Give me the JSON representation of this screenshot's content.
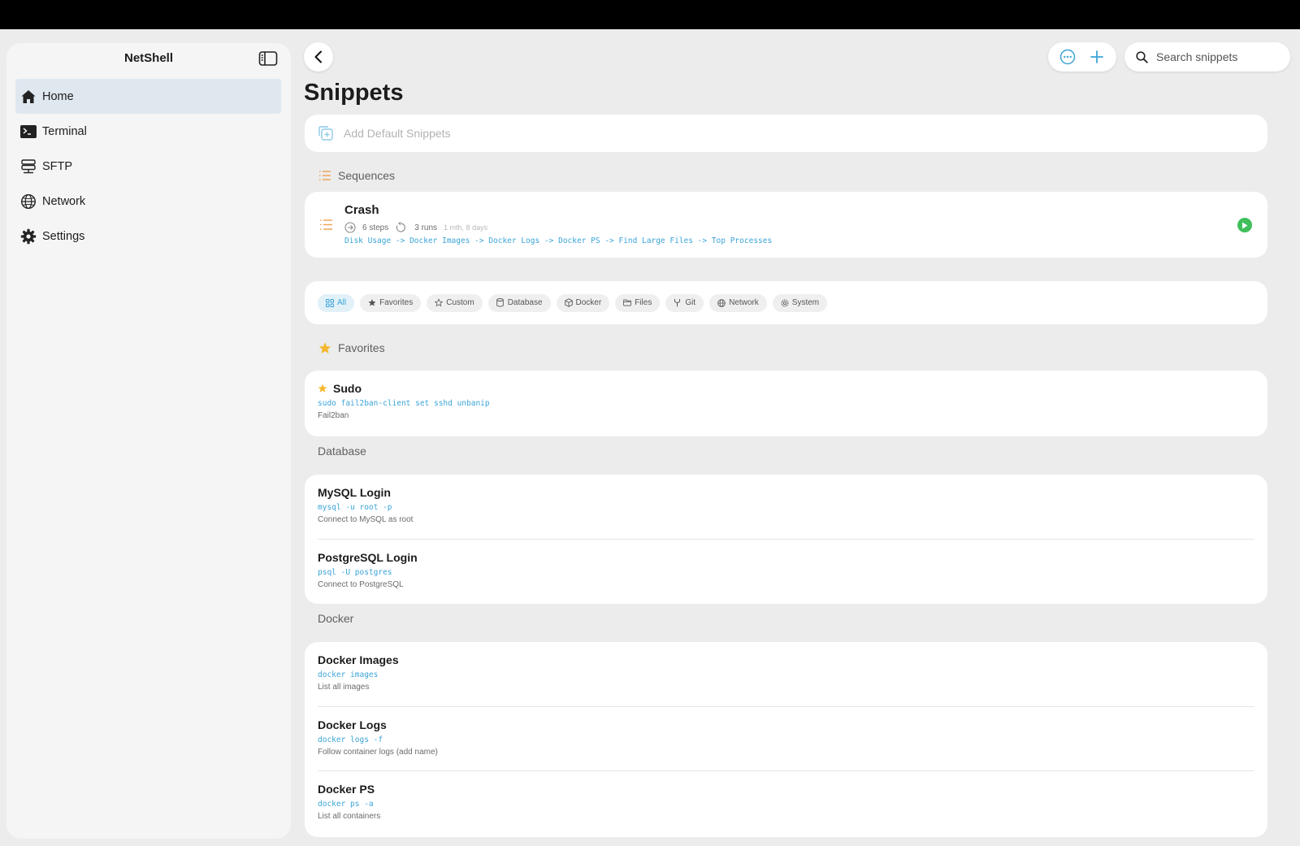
{
  "app": {
    "title": "NetShell"
  },
  "sidebar": {
    "items": [
      {
        "label": "Home",
        "icon": "house-icon"
      },
      {
        "label": "Terminal",
        "icon": "terminal-icon"
      },
      {
        "label": "SFTP",
        "icon": "sftp-icon"
      },
      {
        "label": "Network",
        "icon": "globe-icon"
      },
      {
        "label": "Settings",
        "icon": "gear-icon"
      }
    ],
    "active": "Home"
  },
  "header": {
    "title": "Snippets",
    "search_placeholder": "Search snippets"
  },
  "add_default": {
    "label": "Add Default Snippets"
  },
  "sequences": {
    "header": "Sequences",
    "items": [
      {
        "name": "Crash",
        "steps": "6 steps",
        "runs": "3 runs",
        "last_run": "1 mth, 8 days",
        "flow": "Disk Usage -> Docker Images -> Docker Logs -> Docker PS -> Find Large Files -> Top Processes"
      }
    ]
  },
  "filters": [
    {
      "label": "All",
      "icon": "grid-icon",
      "active": true
    },
    {
      "label": "Favorites",
      "icon": "star-filled-icon",
      "active": false
    },
    {
      "label": "Custom",
      "icon": "star-outline-icon",
      "active": false
    },
    {
      "label": "Database",
      "icon": "database-icon",
      "active": false
    },
    {
      "label": "Docker",
      "icon": "cube-icon",
      "active": false
    },
    {
      "label": "Files",
      "icon": "folder-icon",
      "active": false
    },
    {
      "label": "Git",
      "icon": "branch-icon",
      "active": false
    },
    {
      "label": "Network",
      "icon": "globe-icon",
      "active": false
    },
    {
      "label": "System",
      "icon": "gear-icon",
      "active": false
    }
  ],
  "favorites": {
    "header": "Favorites",
    "items": [
      {
        "name": "Sudo",
        "command": "sudo fail2ban-client set sshd unbanip",
        "description": "Fail2ban"
      }
    ]
  },
  "database": {
    "header": "Database",
    "items": [
      {
        "name": "MySQL Login",
        "command": "mysql -u root -p",
        "description": "Connect to MySQL as root"
      },
      {
        "name": "PostgreSQL Login",
        "command": "psql -U postgres",
        "description": "Connect to PostgreSQL"
      }
    ]
  },
  "docker": {
    "header": "Docker",
    "items": [
      {
        "name": "Docker Images",
        "command": "docker images",
        "description": "List all images"
      },
      {
        "name": "Docker Logs",
        "command": "docker logs -f",
        "description": "Follow container logs (add name)"
      },
      {
        "name": "Docker PS",
        "command": "docker ps -a",
        "description": "List all containers"
      }
    ]
  },
  "colors": {
    "accent": "#3ba4d8",
    "orange": "#f0a050",
    "green": "#3fbf5c",
    "star": "#f5b82e"
  }
}
